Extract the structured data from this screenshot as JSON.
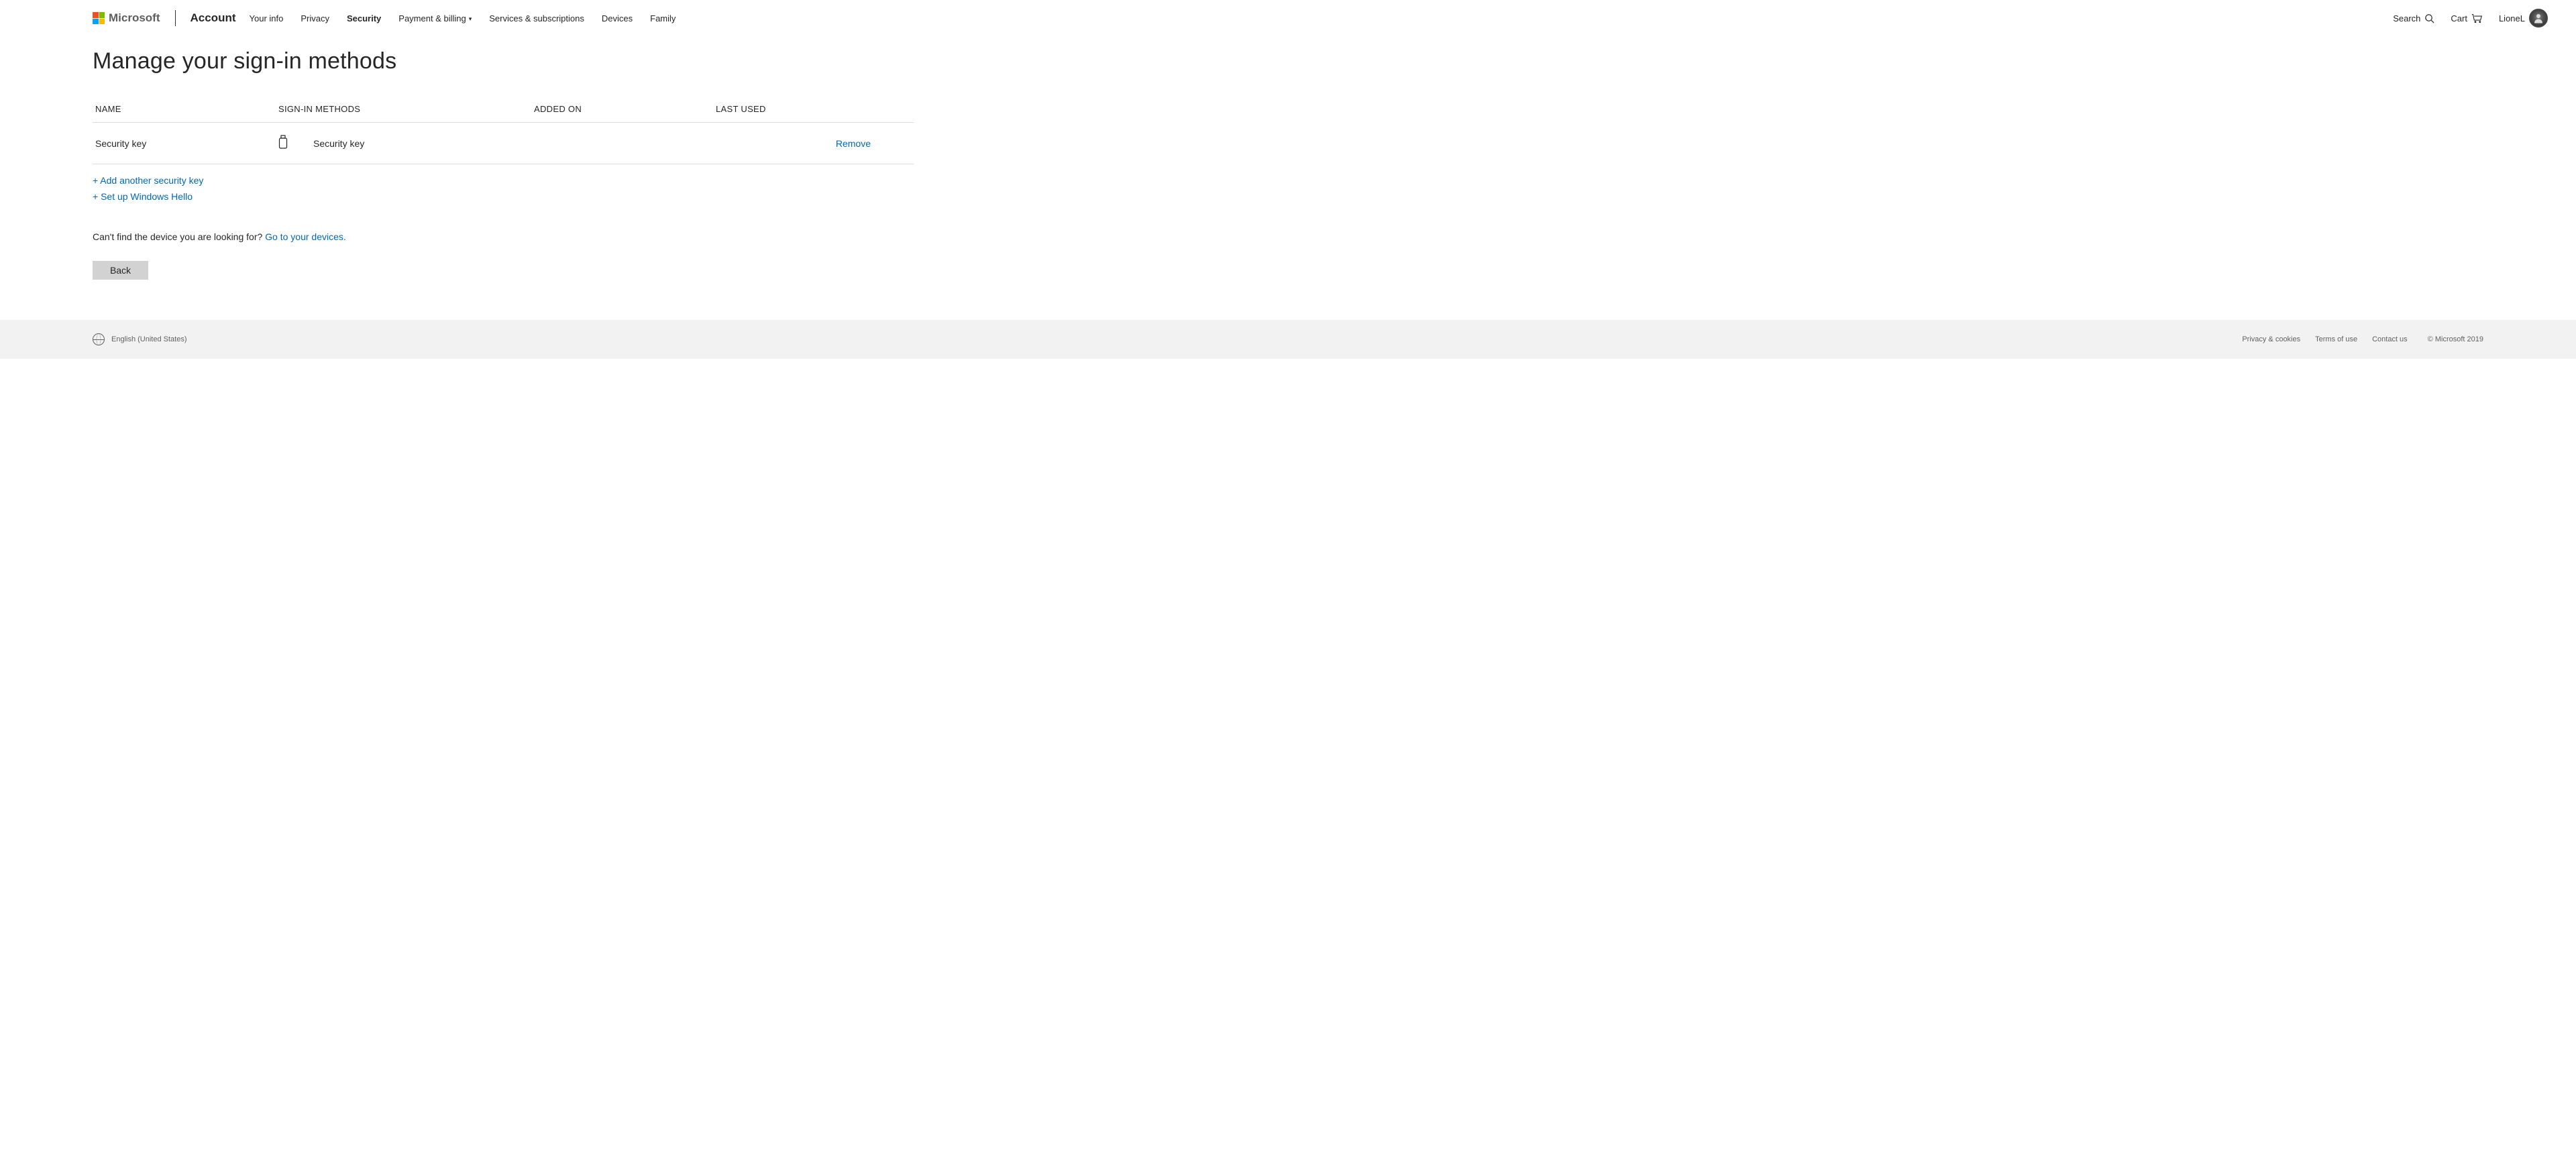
{
  "header": {
    "brand": "Microsoft",
    "app": "Account",
    "nav": [
      {
        "label": "Your info",
        "active": false,
        "dropdown": false
      },
      {
        "label": "Privacy",
        "active": false,
        "dropdown": false
      },
      {
        "label": "Security",
        "active": true,
        "dropdown": false
      },
      {
        "label": "Payment & billing",
        "active": false,
        "dropdown": true
      },
      {
        "label": "Services & subscriptions",
        "active": false,
        "dropdown": false
      },
      {
        "label": "Devices",
        "active": false,
        "dropdown": false
      },
      {
        "label": "Family",
        "active": false,
        "dropdown": false
      }
    ],
    "search_label": "Search",
    "cart_label": "Cart",
    "user_name": "LioneL"
  },
  "page": {
    "title": "Manage your sign-in methods",
    "columns": {
      "name": "NAME",
      "method": "SIGN-IN METHODS",
      "added": "ADDED ON",
      "last": "LAST USED"
    },
    "rows": [
      {
        "name": "Security key",
        "method": "Security key",
        "added": "",
        "last": "",
        "action": "Remove",
        "icon": "usb-key-icon"
      }
    ],
    "add_links": [
      "+ Add another security key",
      "+ Set up Windows Hello"
    ],
    "hint_prefix": "Can't find the device you are looking for? ",
    "hint_link": "Go to your devices.",
    "back_label": "Back"
  },
  "footer": {
    "locale": "English (United States)",
    "links": [
      "Privacy & cookies",
      "Terms of use",
      "Contact us"
    ],
    "copyright": "© Microsoft 2019"
  }
}
